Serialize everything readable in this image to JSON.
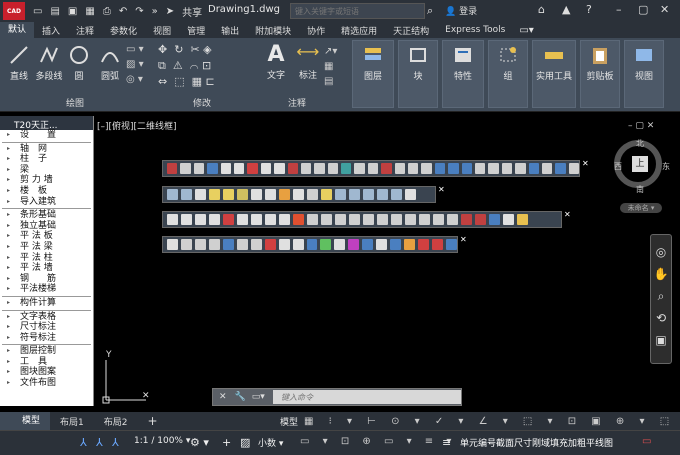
{
  "title_bar": {
    "logo": "CAD",
    "share": "共享",
    "document": "Drawing1.dwg",
    "search_placeholder": "键入关键字或短语",
    "login": "登录"
  },
  "tabs": [
    "默认",
    "插入",
    "注释",
    "参数化",
    "视图",
    "管理",
    "输出",
    "附加模块",
    "协作",
    "精选应用",
    "天正结构",
    "Express Tools"
  ],
  "ribbon": {
    "draw_group": "绘图",
    "modify_group": "修改",
    "annot_group": "注释",
    "draw": [
      "直线",
      "多段线",
      "圆",
      "圆弧"
    ],
    "annot": [
      "文字",
      "标注"
    ],
    "panels": [
      "图层",
      "块",
      "特性",
      "组",
      "实用工具",
      "剪贴板",
      "视图"
    ]
  },
  "side": {
    "header": "T20天正...",
    "items": [
      "设　　置",
      "轴　网",
      "柱　子",
      "梁",
      "剪 力 墙",
      "楼　板",
      "导入建筑",
      "条形基础",
      "独立基础",
      "平 法 板",
      "平 法 梁",
      "平 法 柱",
      "平 法 墙",
      "钢　　筋",
      "平法楼梯",
      "构件计算",
      "文字表格",
      "尺寸标注",
      "符号标注",
      "图层控制",
      "工　具",
      "图块图案",
      "文件布图"
    ]
  },
  "viewport": {
    "label": "[–][俯视][二维线框]",
    "north": "北",
    "south": "南",
    "west": "西",
    "east": "东",
    "top": "上",
    "ucs": "未命名",
    "y_axis": "Y"
  },
  "command": {
    "placeholder": "键入命令"
  },
  "layout_tabs": [
    "模型",
    "布局1",
    "布局2"
  ],
  "status": {
    "model": "模型",
    "scale": "1:1 / 100%",
    "units": "小数",
    "info": "单元编号截面尺寸刚域填充加粗平线图"
  }
}
